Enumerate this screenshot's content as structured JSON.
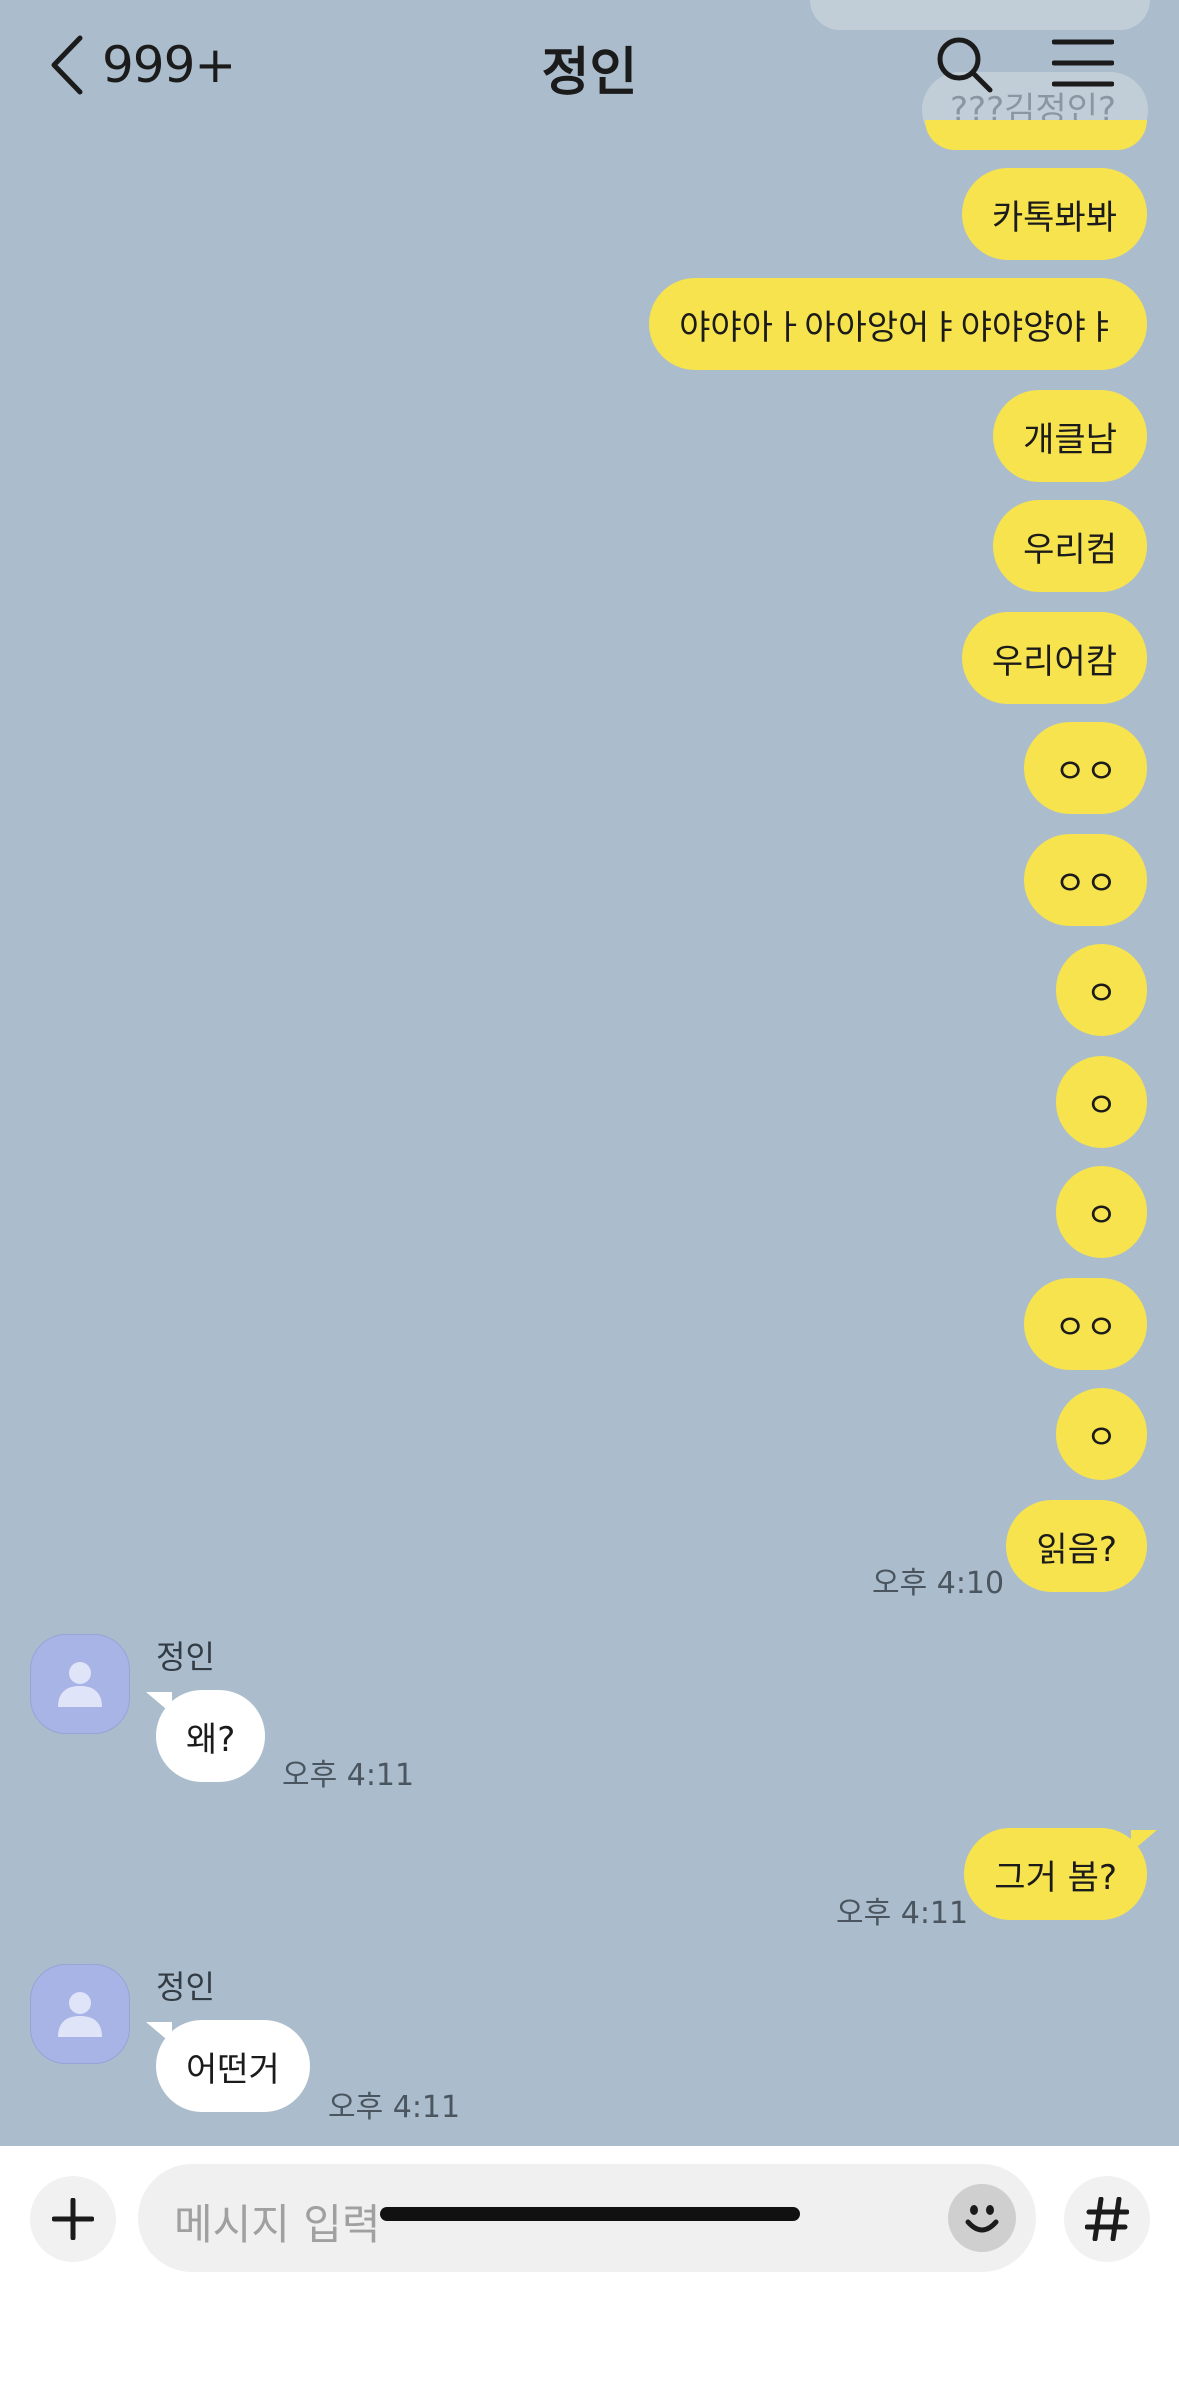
{
  "header": {
    "back_count": "999+",
    "title": "정인"
  },
  "faded": {
    "top_text": "???김정인?"
  },
  "messages_sent": [
    "카톡봐봐",
    "야야아ㅏ아아앙어ㅑ야야양야ㅑ",
    "개클남",
    "우리컴",
    "우리어캄",
    "ㅇㅇ",
    "ㅇㅇ",
    "ㅇ",
    "ㅇ",
    "ㅇ",
    "ㅇㅇ",
    "ㅇ",
    "읽음?"
  ],
  "sent_time_1": "오후 4:10",
  "received_1": {
    "sender": "정인",
    "text": "왜?",
    "time": "오후 4:11"
  },
  "sent_2": {
    "text": "그거 봄?",
    "time": "오후 4:11"
  },
  "received_2": {
    "sender": "정인",
    "text": "어떤거",
    "time": "오후 4:11"
  },
  "input": {
    "placeholder": "메시지 입력"
  },
  "colors": {
    "chat_bg": "#abbdcc",
    "sent_bubble": "#f7e34d",
    "received_bubble": "#ffffff"
  },
  "icons": [
    "back-icon",
    "search-icon",
    "menu-icon",
    "plus-icon",
    "emoji-icon",
    "hash-icon",
    "person-icon"
  ]
}
